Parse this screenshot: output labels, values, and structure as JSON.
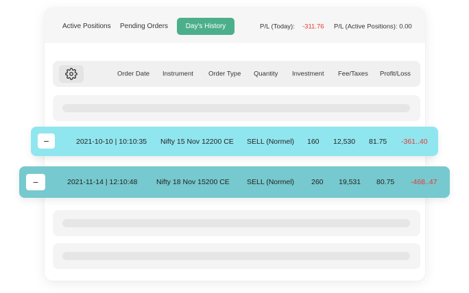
{
  "tabs": {
    "active_positions": "Active Positions",
    "pending_orders": "Pending Orders",
    "days_history": "Day's History"
  },
  "pl": {
    "today_label": "P/L (Today):",
    "today_value": "-311.76",
    "active_label": "P/L (Active Positions): 0.00"
  },
  "columns": [
    "Order Date",
    "Instrument",
    "Order Type",
    "Quantity",
    "Investment",
    "Fee/Taxes",
    "Profit/Loss"
  ],
  "rows": [
    {
      "button": "−",
      "date": "2021-10-10 | 10:10:35",
      "instrument": "Nifty 15 Nov 12200 CE",
      "order_type": "SELL (Normel)",
      "quantity": "160",
      "investment": "12,530",
      "fee": "81.75",
      "pl": "-361..40"
    },
    {
      "button": "−",
      "date": "2021-11-14 | 12:10:48",
      "instrument": "Nifty 18 Nov 15200 CE",
      "order_type": "SELL (Normel)",
      "quantity": "260",
      "investment": "19,531",
      "fee": "80.75",
      "pl": "-468..47"
    }
  ],
  "icons": {
    "settings": "gear-icon"
  },
  "colors": {
    "accent": "#4caf8b",
    "row1_bg": "#90e6ef",
    "row2_bg": "#76c9ce",
    "loss": "#e53935"
  }
}
